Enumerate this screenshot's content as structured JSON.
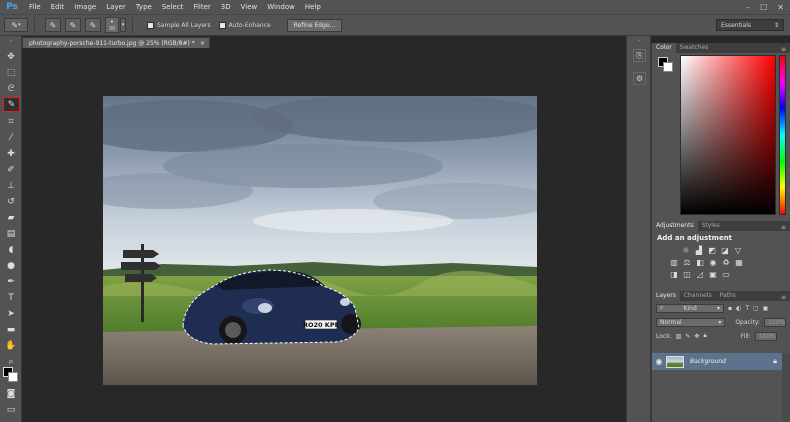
{
  "app": {
    "logo": "Ps"
  },
  "menu": [
    "File",
    "Edit",
    "Image",
    "Layer",
    "Type",
    "Select",
    "Filter",
    "3D",
    "View",
    "Window",
    "Help"
  ],
  "window_controls": [
    "–",
    "☐",
    "✕"
  ],
  "options_bar": {
    "brush_size": "30",
    "sample_all_layers": "Sample All Layers",
    "auto_enhance": "Auto-Enhance",
    "refine_edge": "Refine Edge...",
    "workspace": "Essentials"
  },
  "document": {
    "tab_title": "photography-porsche-911-turbo.jpg @ 25% (RGB/8#) *",
    "close": "×",
    "license_plate": "RO20 KPE"
  },
  "annotation": {
    "arrow_color": "#e01e1e",
    "highlight_color": "#e01e1e"
  },
  "color_panel": {
    "tabs": [
      "Color",
      "Swatches"
    ],
    "foreground": "#000000",
    "background": "#ffffff"
  },
  "adjustments_panel": {
    "tabs": [
      "Adjustments",
      "Styles"
    ],
    "title": "Add an adjustment"
  },
  "layers_panel": {
    "tabs": [
      "Layers",
      "Channels",
      "Paths"
    ],
    "filter": "Kind",
    "blend_mode": "Normal",
    "opacity_label": "Opacity:",
    "opacity_value": "100%",
    "lock_label": "Lock:",
    "fill_label": "Fill:",
    "fill_value": "100%",
    "layer_name": "Background"
  }
}
